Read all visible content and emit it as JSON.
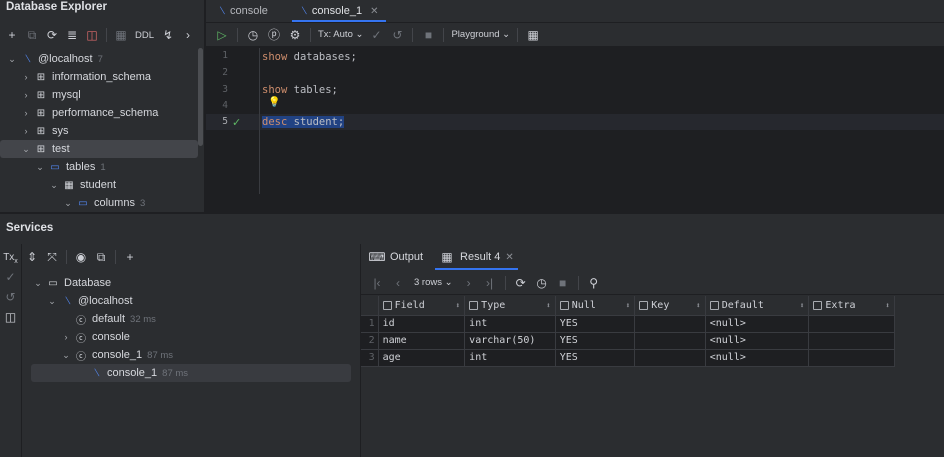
{
  "explorer": {
    "title": "Database Explorer",
    "toolbar": {
      "ddl_label": "DDL"
    },
    "tree": [
      {
        "label": "@localhost",
        "count": "7"
      },
      {
        "label": "information_schema"
      },
      {
        "label": "mysql"
      },
      {
        "label": "performance_schema"
      },
      {
        "label": "sys"
      },
      {
        "label": "test"
      },
      {
        "label": "tables",
        "count": "1"
      },
      {
        "label": "student"
      },
      {
        "label": "columns",
        "count": "3"
      }
    ]
  },
  "editor": {
    "tabs": [
      {
        "label": "console"
      },
      {
        "label": "console_1"
      }
    ],
    "toolbar": {
      "tx_label": "Tx: Auto",
      "playground_label": "Playground"
    },
    "lines": [
      {
        "num": "1",
        "kw": "show",
        "rest": "databases;"
      },
      {
        "num": "2"
      },
      {
        "num": "3",
        "kw": "show",
        "rest": "tables;"
      },
      {
        "num": "4"
      },
      {
        "num": "5",
        "kw": "desc",
        "rest": "student;"
      }
    ]
  },
  "services": {
    "title": "Services",
    "tx_label": "Tx",
    "tree": [
      {
        "label": "Database"
      },
      {
        "label": "@localhost"
      },
      {
        "label": "default",
        "time": "32 ms"
      },
      {
        "label": "console"
      },
      {
        "label": "console_1",
        "time": "87 ms"
      },
      {
        "label": "console_1",
        "time": "87 ms"
      }
    ],
    "result_tabs": [
      {
        "label": "Output"
      },
      {
        "label": "Result 4"
      }
    ],
    "rows_label": "3 rows",
    "columns": [
      "Field",
      "Type",
      "Null",
      "Key",
      "Default",
      "Extra"
    ],
    "rows": [
      {
        "num": "1",
        "field": "id",
        "type": "int",
        "null": "YES",
        "key": "",
        "default": "<null>",
        "extra": ""
      },
      {
        "num": "2",
        "field": "name",
        "type": "varchar(50)",
        "null": "YES",
        "key": "",
        "default": "<null>",
        "extra": ""
      },
      {
        "num": "3",
        "field": "age",
        "type": "int",
        "null": "YES",
        "key": "",
        "default": "<null>",
        "extra": ""
      }
    ]
  },
  "colors": {
    "accent": "#3574f0",
    "keyword": "#cf8e6d",
    "selection": "#214283",
    "success": "#5fb865",
    "sql_icon": "#548af7"
  }
}
